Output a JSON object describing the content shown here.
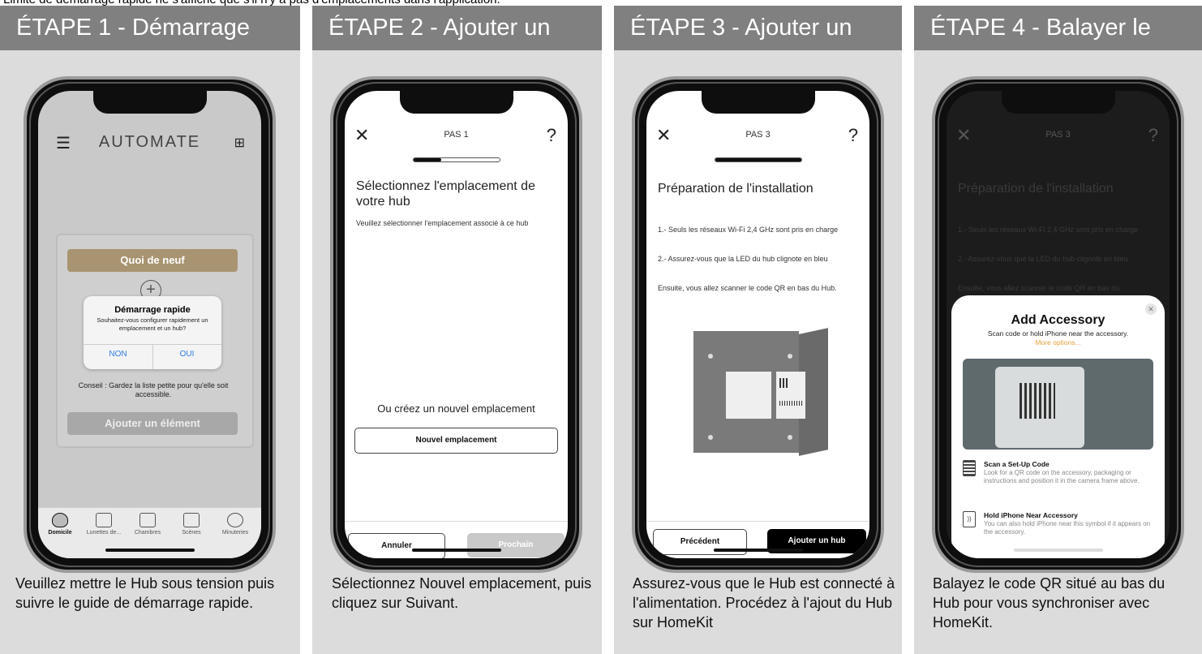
{
  "top_note": "Limite de démarrage rapide ne s'affiche que s'il n'y a pas d'emplacements dans l'application.",
  "steps": [
    {
      "title": "ÉTAPE 1 - Démarrage",
      "caption": "Veuillez mettre le Hub sous tension puis\nsuivre le guide de démarrage rapide.",
      "screen": {
        "brand": "AUTOMATE",
        "whats_new": "Quoi de neuf",
        "dialog_title": "Démarrage rapide",
        "dialog_body": "Souhaitez-vous configurer rapidement un emplacement et un hub?",
        "dialog_no": "NON",
        "dialog_yes": "OUI",
        "tip": "Conseil : Gardez la liste petite pour qu'elle soit accessible.",
        "add_item": "Ajouter un élément",
        "tabs": [
          "Domicile",
          "Lunettes de...",
          "Chambres",
          "Scènes",
          "Minuteries"
        ]
      }
    },
    {
      "title": "ÉTAPE 2 - Ajouter un",
      "caption": "Sélectionnez Nouvel emplacement, puis cliquez sur Suivant.",
      "screen": {
        "step_label": "PAS 1",
        "heading": "Sélectionnez l'emplacement de votre hub",
        "subtext": "Veuillez sélectionner l'emplacement associé à ce hub",
        "create_text": "Ou créez un nouvel emplacement",
        "new_location": "Nouvel emplacement",
        "cancel": "Annuler",
        "next": "Prochain",
        "progress": 0.33
      }
    },
    {
      "title": "ÉTAPE 3 - Ajouter un",
      "caption": "Assurez-vous que le Hub est connecté à l'alimentation. Procédez à l'ajout du Hub sur HomeKit",
      "screen": {
        "step_label": "PAS 3",
        "heading": "Préparation de l'installation",
        "line1": "1.- Seuls les réseaux Wi-Fi 2,4 GHz sont pris en charge",
        "line2": "2.- Assurez-vous que la LED du hub clignote en bleu",
        "line3": "Ensuite, vous allez scanner le code QR en bas du Hub.",
        "prev": "Précédent",
        "add_hub": "Ajouter un hub",
        "progress": 1.0
      }
    },
    {
      "title": "ÉTAPE 4 - Balayer le",
      "caption": "Balayez le code QR situé au bas du Hub pour vous synchroniser avec HomeKit.",
      "screen": {
        "step_label": "PAS 3",
        "heading": "Préparation de l'installation",
        "line1": "1.- Seuls les réseaux Wi-Fi 2,4 GHz sont pris en charge",
        "line2": "2.- Assurez-vous que la LED du hub clignote en bleu",
        "line3": "Ensuite, vous allez scanner le code QR en bas du",
        "sheet_title": "Add Accessory",
        "sheet_sub": "Scan code or hold iPhone near the accessory.",
        "sheet_more": "More options...",
        "opt1_title": "Scan a Set-Up Code",
        "opt1_body": "Look for a QR code on the accessory, packaging or instructions and position it in the camera frame above.",
        "opt2_title": "Hold iPhone Near Accessory",
        "opt2_body": "You can also hold iPhone near this symbol if it appears on the accessory."
      }
    }
  ],
  "colors": {
    "header": "#808080",
    "card": "#dcdcdc",
    "gold": "#a89470",
    "blue": "#2f7ce0",
    "orange": "#e5a03a"
  }
}
